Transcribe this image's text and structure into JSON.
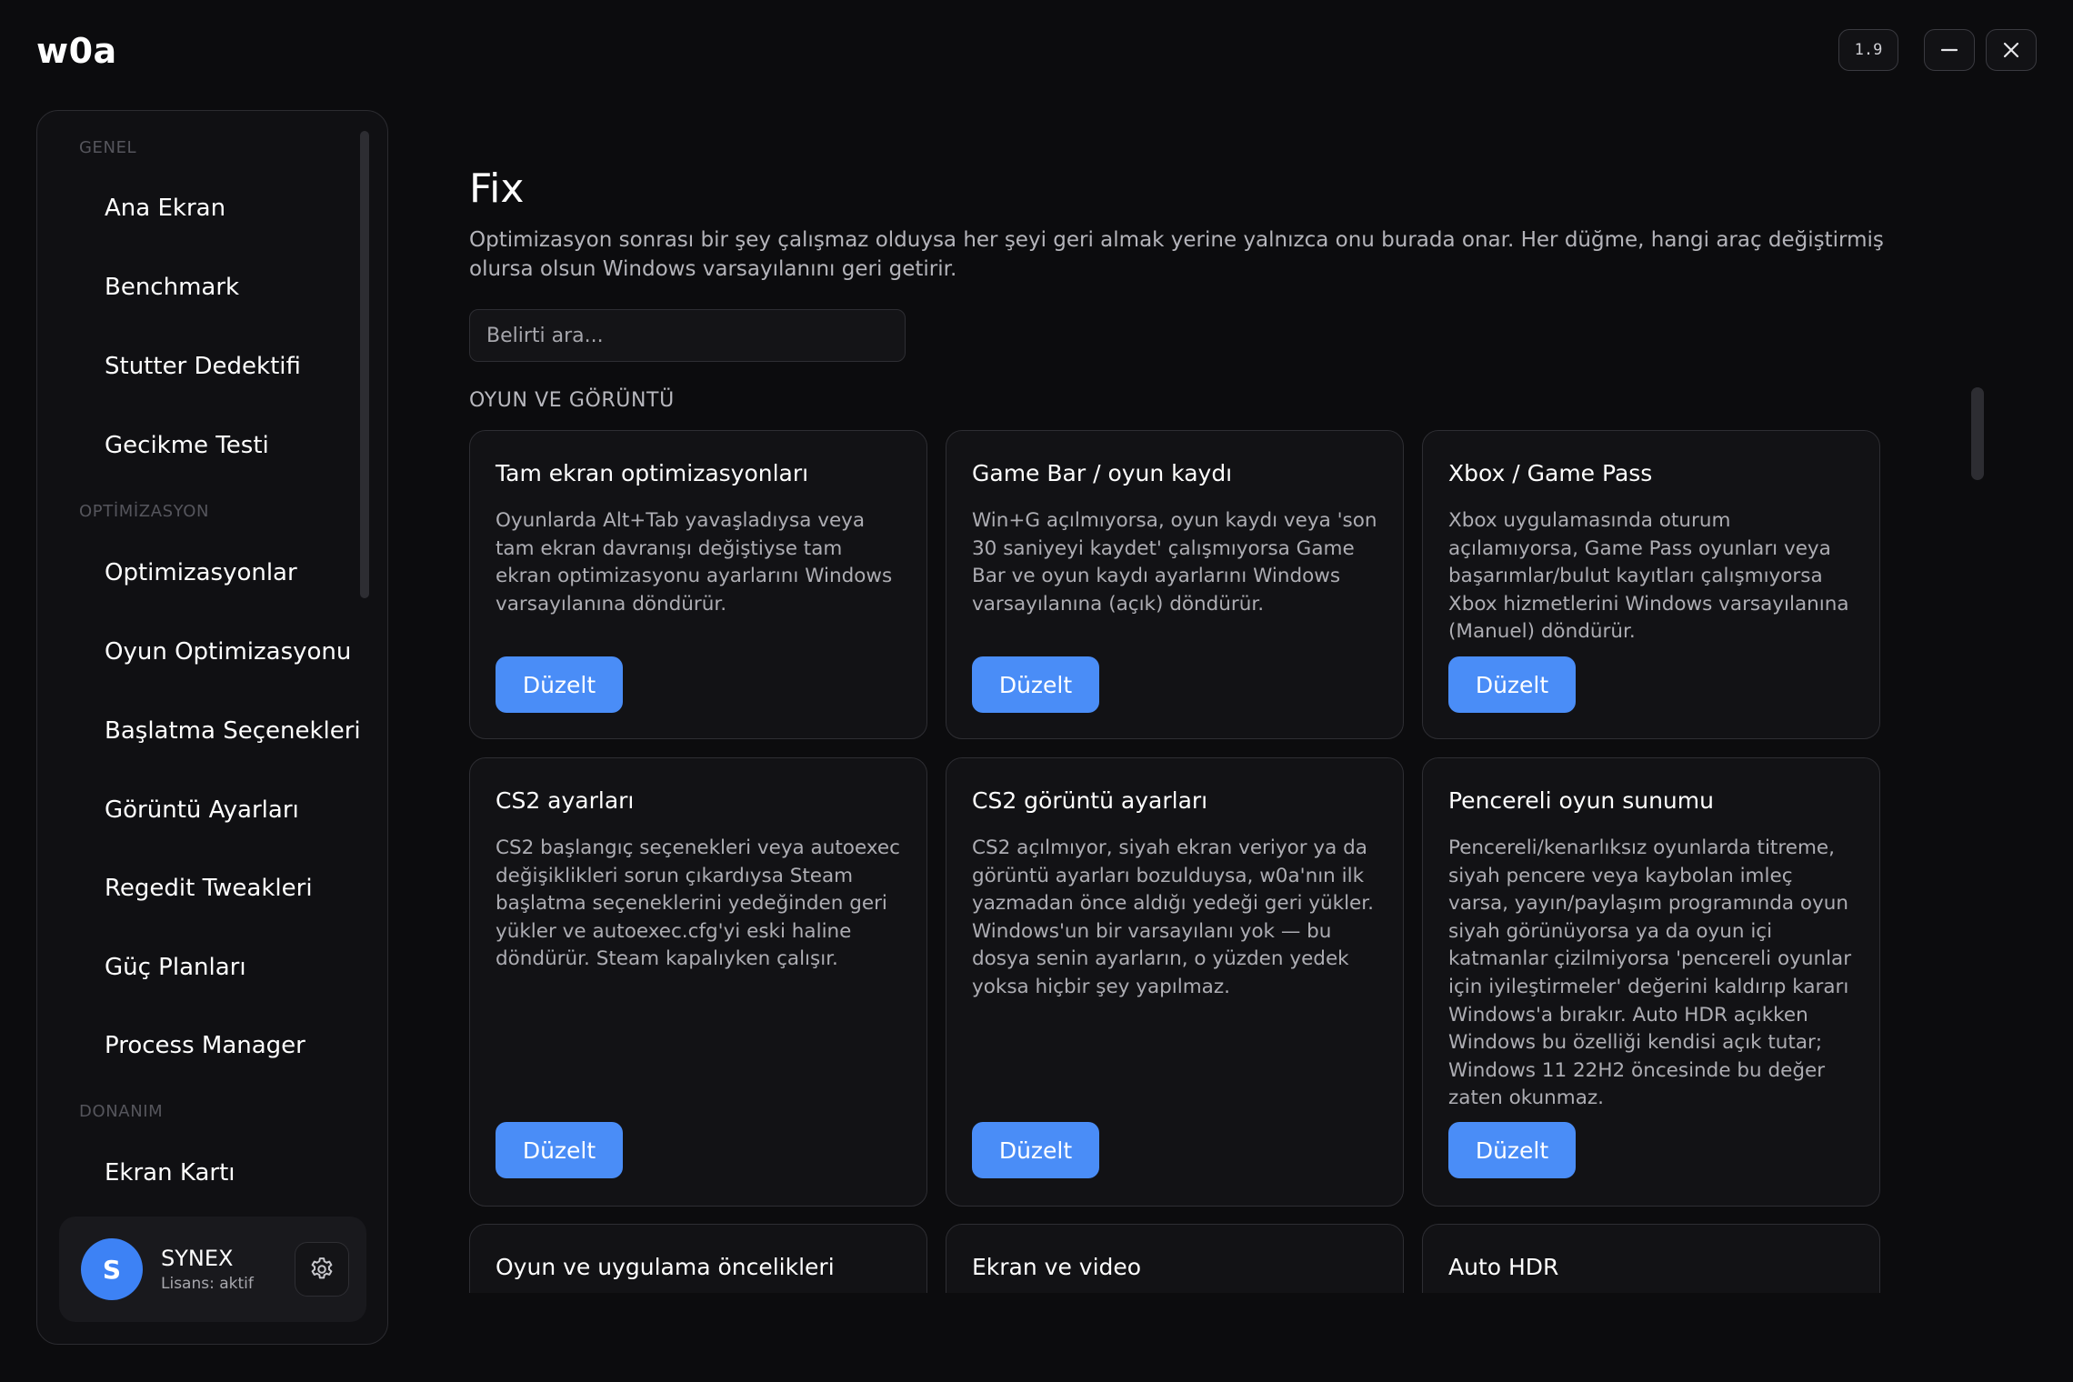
{
  "app": {
    "title": "w0a",
    "version": "1.9"
  },
  "sidebar": {
    "sections": [
      {
        "label": "GENEL",
        "items": [
          "Ana Ekran",
          "Benchmark",
          "Stutter Dedektifi",
          "Gecikme Testi"
        ]
      },
      {
        "label": "OPTİMİZASYON",
        "items": [
          "Optimizasyonlar",
          "Oyun Optimizasyonu",
          "Başlatma Seçenekleri",
          "Görüntü Ayarları",
          "Regedit Tweakleri",
          "Güç Planları",
          "Process Manager"
        ]
      },
      {
        "label": "DONANIM",
        "items": [
          "Ekran Kartı"
        ]
      }
    ],
    "user": {
      "initial": "S",
      "name": "SYNEX",
      "license": "Lisans: aktif"
    }
  },
  "main": {
    "title": "Fix",
    "description": "Optimizasyon sonrası bir şey çalışmaz olduysa her şeyi geri almak yerine yalnızca onu burada onar. Her düğme, hangi araç değiştirmiş olursa olsun Windows varsayılanını geri getirir.",
    "search_placeholder": "Belirti ara...",
    "section_label": "OYUN VE GÖRÜNTÜ",
    "button_label": "Düzelt",
    "cards": [
      {
        "title": "Tam ekran optimizasyonları",
        "desc": "Oyunlarda Alt+Tab yavaşladıysa veya tam ekran davranışı değiştiyse tam ekran optimizasyonu ayarlarını Windows varsayılanına döndürür."
      },
      {
        "title": "Game Bar / oyun kaydı",
        "desc": "Win+G açılmıyorsa, oyun kaydı veya 'son 30 saniyeyi kaydet' çalışmıyorsa Game Bar ve oyun kaydı ayarlarını Windows varsayılanına (açık) döndürür."
      },
      {
        "title": "Xbox / Game Pass",
        "desc": "Xbox uygulamasında oturum açılamıyorsa, Game Pass oyunları veya başarımlar/bulut kayıtları çalışmıyorsa Xbox hizmetlerini Windows varsayılanına (Manuel) döndürür."
      },
      {
        "title": "CS2 ayarları",
        "desc": "CS2 başlangıç seçenekleri veya autoexec değişiklikleri sorun çıkardıysa Steam başlatma seçeneklerini yedeğinden geri yükler ve autoexec.cfg'yi eski haline döndürür. Steam kapalıyken çalışır."
      },
      {
        "title": "CS2 görüntü ayarları",
        "desc": "CS2 açılmıyor, siyah ekran veriyor ya da görüntü ayarları bozulduysa, w0a'nın ilk yazmadan önce aldığı yedeği geri yükler. Windows'un bir varsayılanı yok — bu dosya senin ayarların, o yüzden yedek yoksa hiçbir şey yapılmaz."
      },
      {
        "title": "Pencereli oyun sunumu",
        "desc": "Pencereli/kenarlıksız oyunlarda titreme, siyah pencere veya kaybolan imleç varsa, yayın/paylaşım programında oyun siyah görünüyorsa ya da oyun içi katmanlar çizilmiyorsa 'pencereli oyunlar için iyileştirmeler' değerini kaldırıp kararı Windows'a bırakır. Auto HDR açıkken Windows bu özelliği kendisi açık tutar; Windows 11 22H2 öncesinde bu değer zaten okunmaz."
      },
      {
        "title": "Oyun ve uygulama öncelikleri",
        "desc": ""
      },
      {
        "title": "Ekran ve video",
        "desc": ""
      },
      {
        "title": "Auto HDR",
        "desc": ""
      }
    ]
  },
  "colors": {
    "accent": "#4a8df7",
    "background": "#0c0c0e",
    "card": "#121215"
  }
}
